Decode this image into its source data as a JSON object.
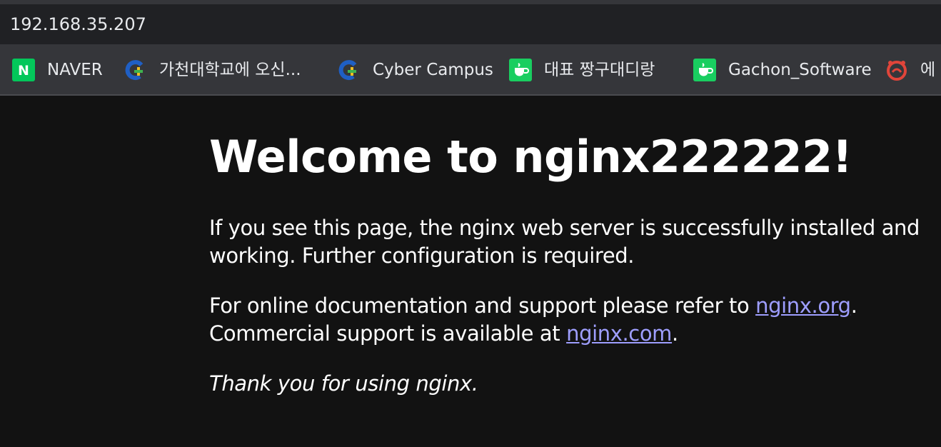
{
  "address_bar": {
    "url": "192.168.35.207"
  },
  "bookmarks": [
    {
      "label": "NAVER",
      "icon": "naver-icon"
    },
    {
      "label": "가천대학교에 오신...",
      "icon": "gachon-icon"
    },
    {
      "label": "Cyber Campus",
      "icon": "gachon-icon"
    },
    {
      "label": "대표 짱구대디랑",
      "icon": "kakao-cup-icon"
    },
    {
      "label": "Gachon_Software",
      "icon": "kakao-cup-icon"
    },
    {
      "label": "에",
      "icon": "red-alarm-icon"
    }
  ],
  "page": {
    "title": "Welcome to nginx222222!",
    "para1": "If you see this page, the nginx web server is successfully installed and working. Further configuration is required.",
    "para2_prefix": "For online documentation and support please refer to ",
    "link_org": "nginx.org",
    "para2_mid": ".",
    "para2_line2": "Commercial support is available at ",
    "link_com": "nginx.com",
    "para2_suffix": ".",
    "para3": "Thank you for using nginx."
  },
  "colors": {
    "background": "#121212",
    "link": "#9e9eff",
    "naver_green": "#03c75a",
    "kakao_green": "#19ce60"
  }
}
